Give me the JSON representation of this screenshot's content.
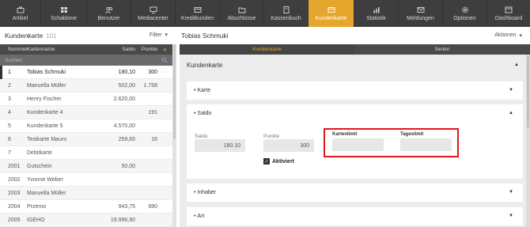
{
  "nav": [
    {
      "label": "Artikel",
      "icon": "suitcase-icon"
    },
    {
      "label": "Schablone",
      "icon": "grid-icon"
    },
    {
      "label": "Benutzer",
      "icon": "users-icon"
    },
    {
      "label": "Mediacenter",
      "icon": "monitor-icon"
    },
    {
      "label": "Kreditkunden",
      "icon": "card-icon"
    },
    {
      "label": "Abschlüsse",
      "icon": "folder-icon"
    },
    {
      "label": "Kassenbuch",
      "icon": "book-icon"
    },
    {
      "label": "Kundenkarte",
      "icon": "card-icon",
      "active": true
    },
    {
      "label": "Statistik",
      "icon": "bar-chart-icon"
    },
    {
      "label": "Meldungen",
      "icon": "envelope-icon"
    },
    {
      "label": "Optionen",
      "icon": "gear-icon"
    },
    {
      "label": "Dashboard",
      "icon": "dashboard-icon"
    }
  ],
  "left": {
    "title": "Kundenkarte",
    "count": "101",
    "filter": "Filter",
    "columns": [
      "Nummer",
      "Kartenname",
      "Saldo",
      "Punkte",
      "+"
    ],
    "search_placeholder": "Suchen",
    "rows": [
      {
        "num": "1",
        "name": "Tobias Schmuki",
        "saldo": "180,10",
        "punkte": "300",
        "more": "···",
        "selected": true
      },
      {
        "num": "2",
        "name": "Manuella Müller",
        "saldo": "502,00",
        "punkte": "1.758"
      },
      {
        "num": "3",
        "name": "Henry Fischer",
        "saldo": "2.620,00",
        "punkte": ""
      },
      {
        "num": "4",
        "name": "Kundenkarte 4",
        "saldo": "",
        "punkte": "191"
      },
      {
        "num": "5",
        "name": "Kundenkarte 5",
        "saldo": "4.570,00",
        "punkte": ""
      },
      {
        "num": "6",
        "name": "Testkarte Mauro",
        "saldo": "259,65",
        "punkte": "16"
      },
      {
        "num": "7",
        "name": "Debitkarte",
        "saldo": "",
        "punkte": ""
      },
      {
        "num": "2001",
        "name": "Gutschein",
        "saldo": "50,00",
        "punkte": ""
      },
      {
        "num": "2002",
        "name": "Yvonne Weber",
        "saldo": "",
        "punkte": ""
      },
      {
        "num": "2003",
        "name": "Manuella Müller",
        "saldo": "",
        "punkte": ""
      },
      {
        "num": "2004",
        "name": "Przemo",
        "saldo": "943,75",
        "punkte": "990"
      },
      {
        "num": "2005",
        "name": "IGEHO",
        "saldo": "19.996,90",
        "punkte": ""
      }
    ]
  },
  "right": {
    "title": "Tobias Schmuki",
    "aktionen": "Aktionen",
    "tabs": [
      "Kundenkarte",
      "Serien"
    ],
    "section_title": "Kundenkarte",
    "acc_karte": "Karte",
    "acc_saldo": "Saldo",
    "acc_inhaber": "Inhaber",
    "acc_art": "Art",
    "saldo_label": "Saldo",
    "saldo_value": "180.10",
    "punkte_label": "Punkte",
    "punkte_value": "300",
    "kartenlimit_label": "Kartenlimit",
    "kartenlimit_value": "",
    "tageslimit_label": "Tageslimit",
    "tageslimit_value": "",
    "aktiviert_label": "Aktiviert",
    "aktiviert_checked": true
  },
  "colors": {
    "accent": "#e6a52c",
    "nav_bg": "#3e3e3e",
    "highlight": "#e0181e"
  }
}
